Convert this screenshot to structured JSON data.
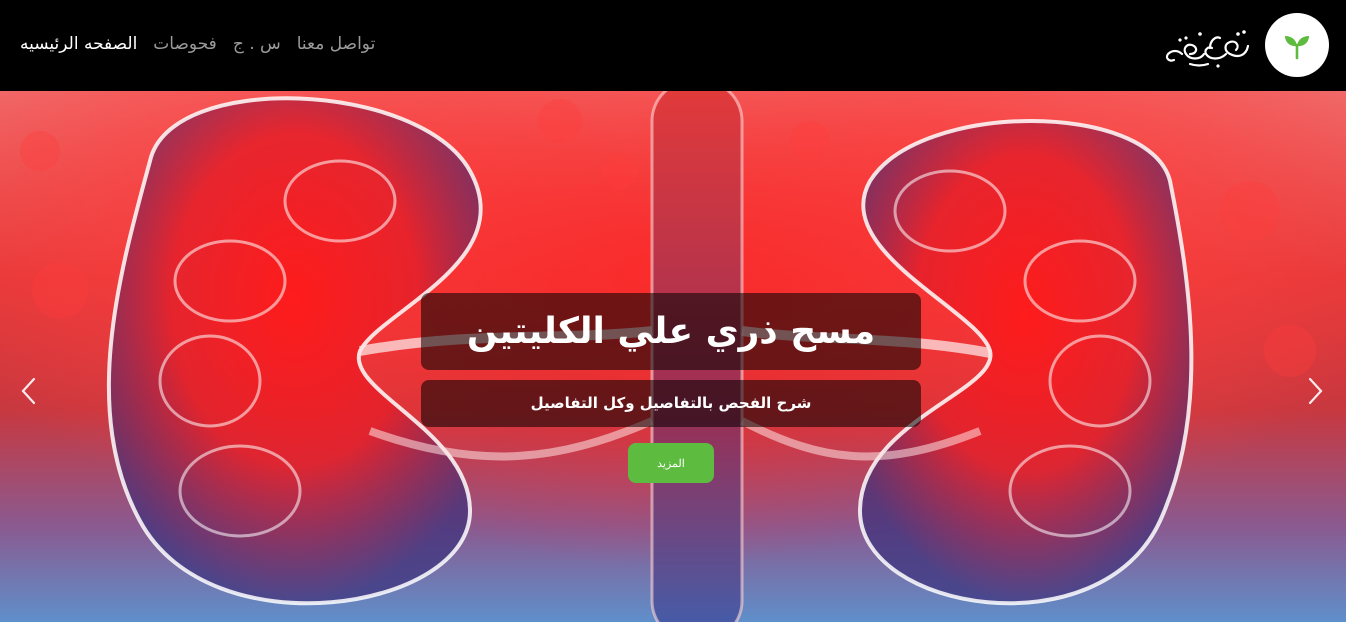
{
  "nav": {
    "brand": "نصيحة",
    "links": [
      {
        "label": "الصفحه الرئيسيه",
        "active": true
      },
      {
        "label": "فحوصات",
        "active": false
      },
      {
        "label": "س . ج",
        "active": false
      },
      {
        "label": "تواصل معنا",
        "active": false
      }
    ]
  },
  "hero": {
    "title": "مسح ذري علي الكليتين",
    "subtitle": "شرح الفحص بالتفاصيل وكل التفاصيل",
    "button_label": "المزيد"
  },
  "colors": {
    "nav_bg": "#000000",
    "accent_green": "#5dbb3f",
    "nav_text": "#9a9a9a",
    "nav_active": "#ffffff"
  },
  "icons": {
    "logo": "sprout-icon",
    "prev": "chevron-left-icon",
    "next": "chevron-right-icon"
  }
}
